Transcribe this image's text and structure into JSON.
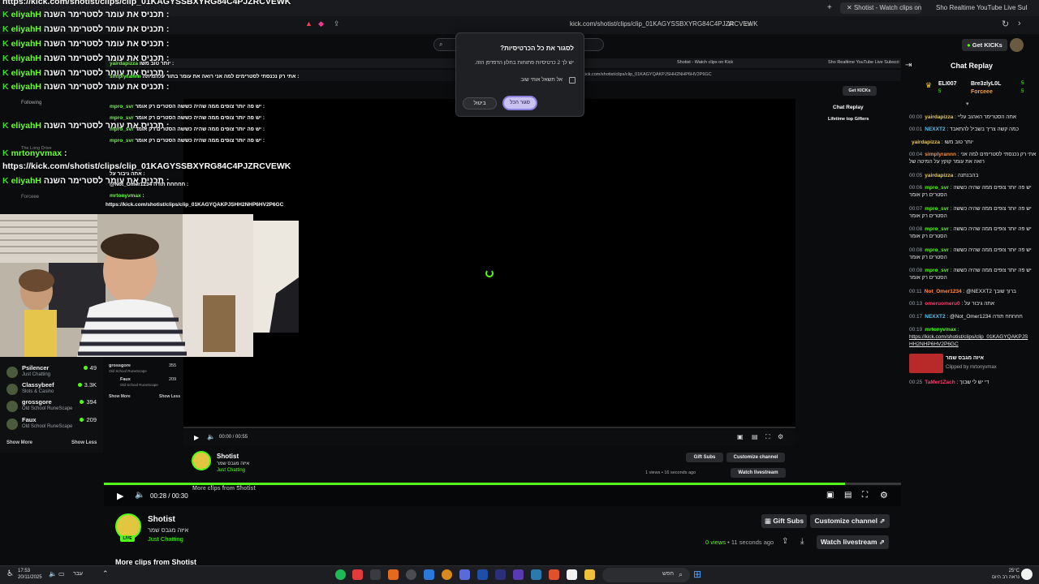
{
  "browser": {
    "tabs": [
      "Shotist - Watch clips on Kick",
      "Sho Realtime YouTube Live Subscrib"
    ],
    "url": "kick.com/shotist/clips/clip_01KAGYSSBXYRG84C4PJZRCVEWK",
    "inner_tabs": [
      "Shotist - Watch clips on Kick",
      "Sho Realtime YouTube Live Subscri"
    ],
    "inner_url": "kick.com/shotist/clips/clip_01KAGYQAKPJSHH2NHP6HV2P6GC"
  },
  "overlay_chat": {
    "url_top": "https://kick.com/shotist/clips/clip_01KAGYSSBXYRG84C4PJZRCVEWK",
    "lines": [
      {
        "user": "eliyahH",
        "msg": "תכניס את עומר לסטרימר השנה :"
      },
      {
        "user": "eliyahH",
        "msg": "תכניס את עומר לסטרימר השנה :"
      },
      {
        "user": "eliyahH",
        "msg": "תכניס את עומר לסטרימר השנה :"
      },
      {
        "user": "eliyahH",
        "msg": "תכניס את עומר לסטרימר השנה :"
      },
      {
        "user": "eliyahH",
        "msg": "תכניס את עומר לסטרימר השנה :"
      },
      {
        "user": "eliyahH",
        "msg": "תכניס את עומר לסטרימר השנה :"
      },
      {
        "user": "eliyahH",
        "msg": "תכניס את עומר לסטרימר השנה :"
      },
      {
        "user": "mrtonyvmax",
        "msg": ":"
      },
      {
        "user": "eliyahH",
        "msg": "תכניס את עומר לסטרימר השנה :"
      }
    ],
    "url_bottom": "https://kick.com/shotist/clips/clip_01KAGYSSBXYRG84C4PJZRCVEWK",
    "inner_lines": [
      {
        "user": "yairdapizza",
        "msg": "יותר טוב משו :"
      },
      {
        "user": "simplyrannn",
        "msg": "אתי רק נכנסתי לסטרימים למה אני רואה את עומר בתור עלהמיתה :"
      },
      {
        "user": "mpro_svr",
        "msg": "יש פה יותר צופים ממה שהיה כששה הסטרים רק אומר :"
      },
      {
        "user": "mpro_svr",
        "msg": "יש פה יותר צופים ממה שהיה כששה הסטרים רק אומר :"
      },
      {
        "user": "mpro_svr",
        "msg": "יש פה יותר צופים ממה שהיה כששה הסטרים רק אומר :"
      },
      {
        "user": "mpro_svr",
        "msg": "יש פה יותר צופים ממה שהיה כששה הסטרים רק אומר :"
      },
      {
        "user": "mrtonyvmax",
        "msg": ":"
      }
    ],
    "inner_misc": [
      "אתה גיבור על :",
      "@Not_Omer1234 חחחחח תודה :"
    ],
    "inner_url": "https://kick.com/shotist/clips/clip_01KAGYQAKPJSHH2NHP6HV2P6GC"
  },
  "sidebar": {
    "channels": [
      {
        "name": "Psilencer",
        "category": "Just Chatting",
        "viewers": "49"
      },
      {
        "name": "Classybeef",
        "category": "Slots & Casino",
        "viewers": "3.3K"
      },
      {
        "name": "grossgore",
        "category": "Old School RuneScape",
        "viewers": "394"
      },
      {
        "name": "Faux",
        "category": "Old School RuneScape",
        "viewers": "209"
      }
    ],
    "show_more": "Show More",
    "show_less": "Show Less",
    "inner_channels": [
      {
        "name": "grossgore",
        "category": "Old School RuneScape",
        "viewers": "355"
      },
      {
        "name": "Faux",
        "category": "Old School RuneScape",
        "viewers": "209"
      }
    ],
    "inner_show_more": "Show More",
    "inner_show_less": "Show Less",
    "inner_misc": [
      "Following",
      "Forceee",
      "The Long Drive"
    ]
  },
  "modal": {
    "title": "לסגור את כל הכרטיסיות?",
    "body": "יש לך 2 כרטיסיות פתוחות בחלון הדפדפן הזה.",
    "checkbox_label": "אל תשאל אותי שוב",
    "cancel": "ביטול",
    "close_all": "סגור הכל"
  },
  "inner_player": {
    "time": "00:00 / 00:55",
    "channel": "Shotist",
    "clip_title": "איזה מגבס שמר",
    "category": "Just Chatting",
    "views": "1 views • 16 seconds ago",
    "gift_subs": "Gift Subs",
    "customize": "Customize channel",
    "watch": "Watch livestream",
    "more_clips": "More clips from Shotist",
    "get_kicks": "Get KICKs",
    "chat_replay": "Chat Replay",
    "lifetime_gifters": "Lifetime top Gifters"
  },
  "player": {
    "time": "00:28 / 00:30",
    "channel": "Shotist",
    "clip_title": "איזה מגבס שמר",
    "category": "Just Chatting",
    "views_count": "0 views",
    "views_age": "• 11 seconds ago",
    "gift_subs": "Gift Subs",
    "customize": "Customize channel",
    "watch": "Watch livestream",
    "more_clips": "More clips from Shotist",
    "progress_fraction": 0.93
  },
  "header": {
    "get_kicks": "Get KICKs"
  },
  "chat_replay": {
    "title": "Chat Replay",
    "gifters": [
      {
        "name": "ELI007",
        "count": "5"
      },
      {
        "name": "Bre3zlyL0L",
        "count": "5"
      },
      {
        "name": "Forceee",
        "count": "5"
      }
    ],
    "messages": [
      {
        "time": "00:00",
        "user": "yairdapizza",
        "color": "#f5c542",
        "text": ": אתה הסטרימר האהוב עליי"
      },
      {
        "time": "00:01",
        "user": "NEXXT2",
        "color": "#4fc3f7",
        "text": ": כמה קשה צריך בשביל להתאבד"
      },
      {
        "time": "",
        "user": "yairdapizza",
        "color": "#f5c542",
        "text": ": יותר טוב משו"
      },
      {
        "time": "00:04",
        "user": "simplyrannn",
        "color": "#ff8a3d",
        "text": ": אתי רק נכנסתי לסטרימים למה אני רואה את עומר קוקץ על המיטה של"
      },
      {
        "time": "00:05",
        "user": "yairdapizza",
        "color": "#f5c542",
        "text": ": בהבנתנה"
      },
      {
        "time": "00:06",
        "user": "mpro_svr",
        "color": "#53fc18",
        "text": ": יש פה יותר צופים ממה שהיה כששה הסטרים רק אומר"
      },
      {
        "time": "00:07",
        "user": "mpro_svr",
        "color": "#53fc18",
        "text": ": יש פה יותר צופים ממה שהיה כששה הסטרים רק אומר"
      },
      {
        "time": "00:08",
        "user": "mpro_svr",
        "color": "#53fc18",
        "text": ": יש פה יותר צופים ממה שהיה כששה הסטרים רק אומר"
      },
      {
        "time": "00:08",
        "user": "mpro_svr",
        "color": "#53fc18",
        "text": ": יש פה יותר צופים ממה שהיה כששה הסטרים רק אומר"
      },
      {
        "time": "00:08",
        "user": "mpro_svr",
        "color": "#53fc18",
        "text": ": יש פה יותר צופים ממה שהיה כששה הסטרים רק אומר"
      },
      {
        "time": "00:11",
        "user": "Not_Omer1234",
        "color": "#ff8a3d",
        "text": ": @NEXXT2 ברוך שובך"
      },
      {
        "time": "00:13",
        "user": "omeruomeru0",
        "color": "#ff3d6b",
        "text": ": אתה גיבור על"
      },
      {
        "time": "00:17",
        "user": "NEXXT2",
        "color": "#4fc3f7",
        "text": ": @Not_Omer1234 חחחחח תודה"
      },
      {
        "time": "00:19",
        "user": "mrtonyvmax",
        "color": "#53fc18",
        "text": ":"
      }
    ],
    "link": "https://kick.com/shotist/clips/clip_01KAGYQAKPJSHH2NHP6HV2P6GC",
    "clip_card_title": "איזה מגבס שמר",
    "clip_card_by": "Clipped by mrtonyvmax",
    "last": {
      "time": "00:25",
      "user": "TaMer1Zach",
      "color": "#ff3d6b",
      "text": ": די יש לי שבוך"
    }
  },
  "taskbar": {
    "time": "17:53",
    "date": "20/11/2025",
    "lang": "עבר",
    "search": "חפש",
    "weather": "25°C",
    "weather_desc": "נראה רב היום"
  }
}
